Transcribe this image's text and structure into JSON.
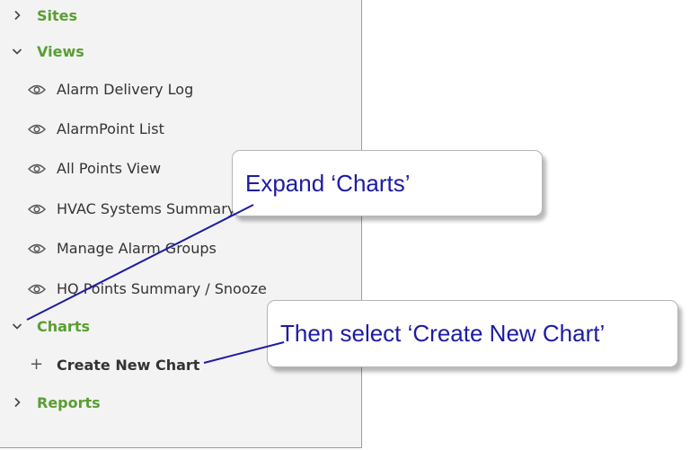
{
  "sidebar": {
    "sections": {
      "sites": {
        "label": "Sites",
        "state": "collapsed"
      },
      "views": {
        "label": "Views",
        "state": "expanded"
      },
      "charts": {
        "label": "Charts",
        "state": "expanded"
      },
      "reports": {
        "label": "Reports",
        "state": "collapsed"
      }
    },
    "views_items": [
      {
        "label": "Alarm Delivery Log",
        "icon": "eye-icon"
      },
      {
        "label": "AlarmPoint List",
        "icon": "eye-icon"
      },
      {
        "label": "All Points View",
        "icon": "eye-icon"
      },
      {
        "label": "HVAC Systems Summary",
        "icon": "eye-icon"
      },
      {
        "label": "Manage Alarm Groups",
        "icon": "eye-icon"
      },
      {
        "label": "HQ Points Summary / Snooze",
        "icon": "eye-icon"
      }
    ],
    "charts_items": [
      {
        "label": "Create New Chart",
        "icon": "plus-icon"
      }
    ]
  },
  "callouts": {
    "expand": "Expand ‘Charts’",
    "select": "Then select ‘Create New Chart’"
  },
  "colors": {
    "section_label": "#5a9e32",
    "item_text": "#333333",
    "callout_text": "#1d1ba3",
    "pointer_line": "#1d1ba3",
    "sidebar_bg": "#f3f3f3"
  }
}
